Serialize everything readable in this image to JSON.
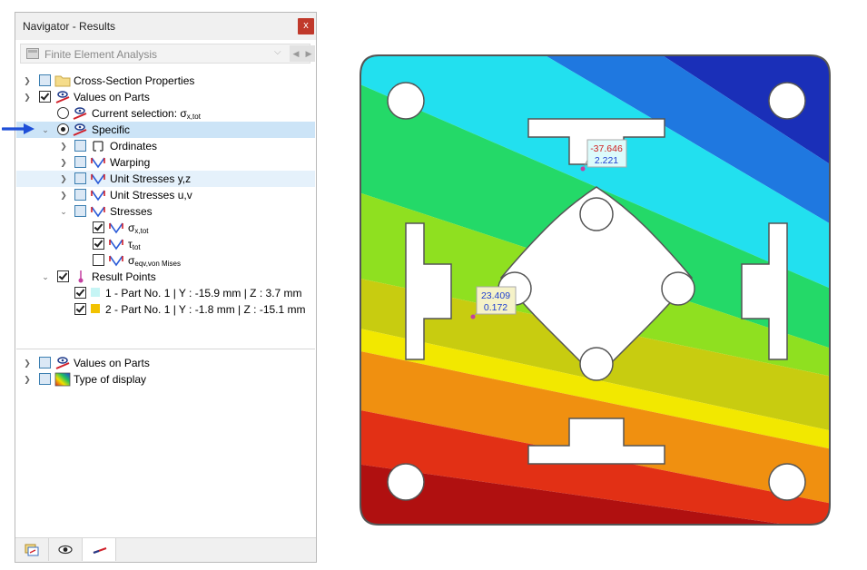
{
  "window": {
    "title": "Navigator - Results",
    "close_label": "x"
  },
  "combo": {
    "value": "Finite Element Analysis"
  },
  "tree": {
    "cross_section": "Cross-Section Properties",
    "values_on_parts": "Values on Parts",
    "current_selection": "Current selection: ",
    "current_symbol": "σ",
    "current_sub": "x,tot",
    "specific": "Specific",
    "ordinates": "Ordinates",
    "warping": "Warping",
    "unit_stresses_yz": "Unit Stresses y,z",
    "unit_stresses_uv": "Unit Stresses u,v",
    "stresses": "Stresses",
    "sigma_x_tot": "σ",
    "sigma_x_tot_sub": "x,tot",
    "tau_tot": "τ",
    "tau_tot_sub": "tot",
    "sigma_eqv": "σ",
    "sigma_eqv_sub": "eqv,von Mises",
    "result_points": "Result Points",
    "point1": "1 - Part No. 1 | Y : -15.9 mm | Z : 3.7 mm",
    "point2": "2 - Part No. 1 | Y : -1.8 mm | Z : -15.1 mm",
    "values_on_parts_2": "Values on Parts",
    "type_of_display": "Type of display"
  },
  "colors": {
    "point1": "#c6f5f5",
    "point2": "#f2c200",
    "arrow": "#1f4fd8"
  },
  "viewport": {
    "label1_top": "-37.646",
    "label1_bottom": "2.221",
    "label2_top": "23.409",
    "label2_bottom": "0.172"
  }
}
